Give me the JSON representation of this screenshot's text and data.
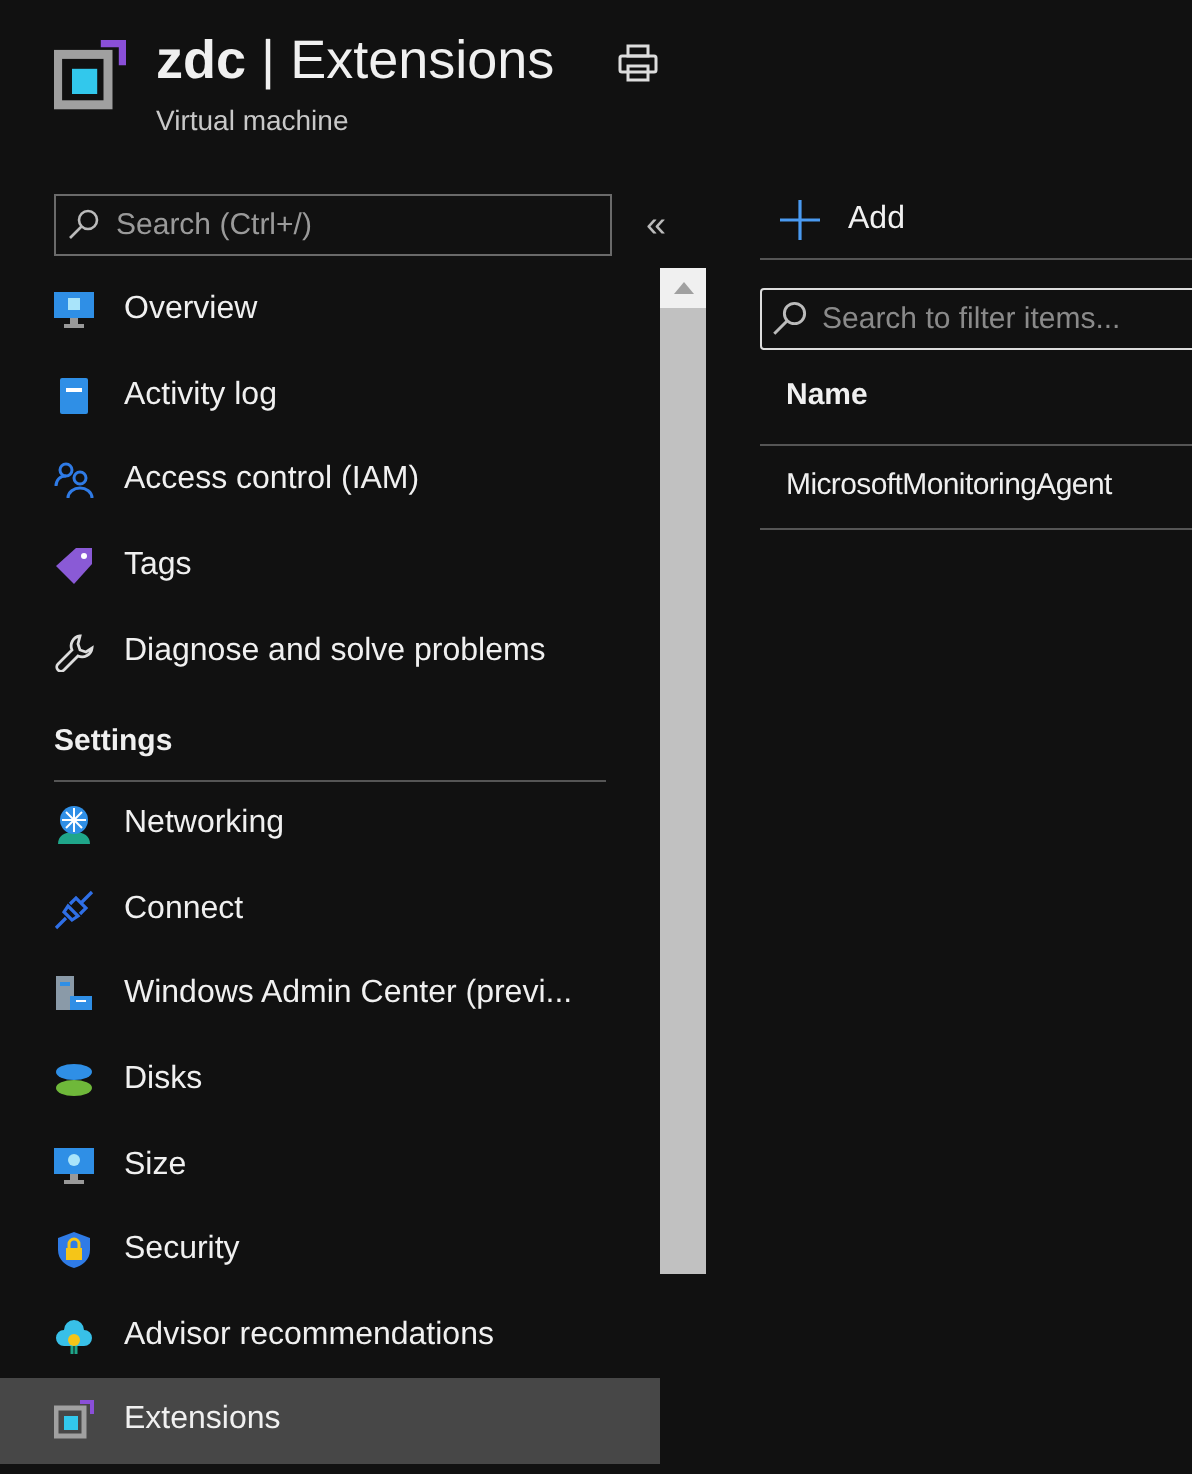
{
  "header": {
    "resource": "zdc",
    "separator": "|",
    "page": "Extensions",
    "subtitle": "Virtual machine"
  },
  "sidebar": {
    "search": {
      "placeholder": "Search (Ctrl+/)"
    },
    "collapse": "«",
    "items": [
      {
        "kind": "item",
        "label": "Overview",
        "selected": false
      },
      {
        "kind": "item",
        "label": "Activity log",
        "selected": false
      },
      {
        "kind": "item",
        "label": "Access control (IAM)",
        "selected": false
      },
      {
        "kind": "item",
        "label": "Tags",
        "selected": false
      },
      {
        "kind": "item",
        "label": "Diagnose and solve problems",
        "selected": false
      },
      {
        "kind": "section",
        "label": "Settings"
      },
      {
        "kind": "item",
        "label": "Networking",
        "selected": false
      },
      {
        "kind": "item",
        "label": "Connect",
        "selected": false
      },
      {
        "kind": "item",
        "label": "Windows Admin Center (previ...",
        "selected": false
      },
      {
        "kind": "item",
        "label": "Disks",
        "selected": false
      },
      {
        "kind": "item",
        "label": "Size",
        "selected": false
      },
      {
        "kind": "item",
        "label": "Security",
        "selected": false
      },
      {
        "kind": "item",
        "label": "Advisor recommendations",
        "selected": false
      },
      {
        "kind": "item",
        "label": "Extensions",
        "selected": true
      }
    ]
  },
  "toolbar": {
    "add": "Add"
  },
  "filter": {
    "placeholder": "Search to filter items..."
  },
  "table": {
    "columns": [
      "Name"
    ],
    "rows": [
      [
        "MicrosoftMonitoringAgent"
      ]
    ]
  }
}
